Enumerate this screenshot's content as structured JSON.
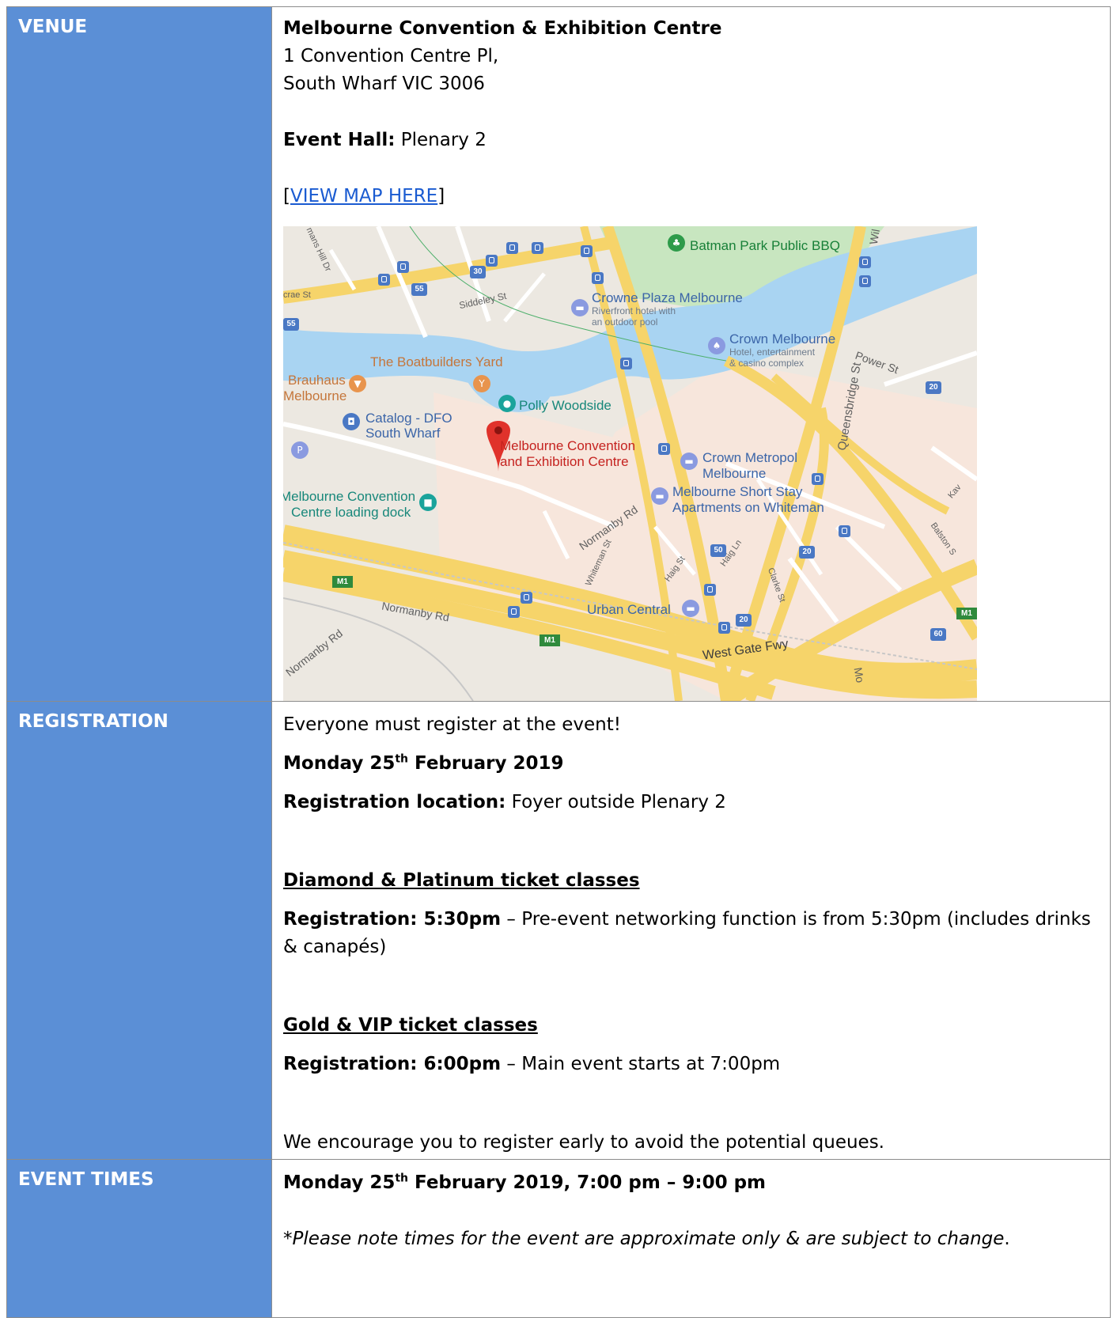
{
  "venue": {
    "label": "VENUE",
    "name": "Melbourne Convention & Exhibition Centre",
    "address_line1": "1 Convention Centre Pl,",
    "address_line2": "South Wharf VIC 3006",
    "hall_label": "Event Hall:",
    "hall_value": " Plenary 2",
    "map_link_open": "[",
    "map_link_text": "VIEW MAP HERE",
    "map_link_close": "]",
    "map": {
      "labels": {
        "batman": "Batman Park Public BBQ",
        "crowne": "Crowne Plaza Melbourne",
        "crowne_sub1": "Riverfront hotel with",
        "crowne_sub2": "an outdoor pool",
        "crown": "Crown Melbourne",
        "crown_sub1": "Hotel, entertainment",
        "crown_sub2": "& casino complex",
        "boatbuilders": "The Boatbuilders Yard",
        "brauhaus1": "Brauhaus",
        "brauhaus2": "Melbourne",
        "polly": "Polly Woodside",
        "catalog1": "Catalog - DFO",
        "catalog2": "South Wharf",
        "mcec1": "Melbourne Convention",
        "mcec2": "and Exhibition Centre",
        "metropol1": "Crown Metropol",
        "metropol2": "Melbourne",
        "shortstay1": "Melbourne Short Stay",
        "shortstay2": "Apartments on Whiteman",
        "dock1": "Melbourne Convention",
        "dock2": "Centre loading dock",
        "urban": "Urban Central",
        "westgate": "West Gate Fwy",
        "normanby1": "Normanby Rd",
        "normanby2": "Normanby Rd",
        "normanby3": "Normanby Rd",
        "power": "Power St",
        "queensbridge": "Queensbridge St",
        "siddeley": "Siddeley St",
        "whiteman": "Whiteman St",
        "haig_st": "Haig St",
        "haig_ln": "Haig Ln",
        "clarke": "Clarke St",
        "crae": "crae St",
        "hill": "mans Hill Dr",
        "kav": "Kav",
        "balston": "Balston S",
        "wil": "Wil",
        "mo": "Mo"
      },
      "shields": [
        "55",
        "55",
        "30",
        "20",
        "50",
        "20",
        "20",
        "60"
      ],
      "m1": "M1"
    }
  },
  "registration": {
    "label": "REGISTRATION",
    "intro": "Everyone must register at the event!",
    "date_pre": "Monday 25",
    "date_sup": "th",
    "date_post": " February 2019",
    "location_label": "Registration location:",
    "location_value": " Foyer outside Plenary 2",
    "group1_heading": "Diamond & Platinum ticket classes",
    "group1_time_label": "Registration: 5:30pm",
    "group1_text": " – Pre-event networking function is from 5:30pm (includes drinks & canapés)",
    "group2_heading": "Gold & VIP ticket classes",
    "group2_time_label": "Registration: 6:00pm",
    "group2_text": " – Main event starts at 7:00pm",
    "closing": "We encourage you to register early to avoid the potential queues."
  },
  "event_times": {
    "label": "EVENT TIMES",
    "date_pre": "Monday 25",
    "date_sup": "th",
    "date_post": " February 2019, 7:00 pm – 9:00 pm",
    "note": "*Please note times for the event are approximate only & are subject to change",
    "note_end": "."
  }
}
